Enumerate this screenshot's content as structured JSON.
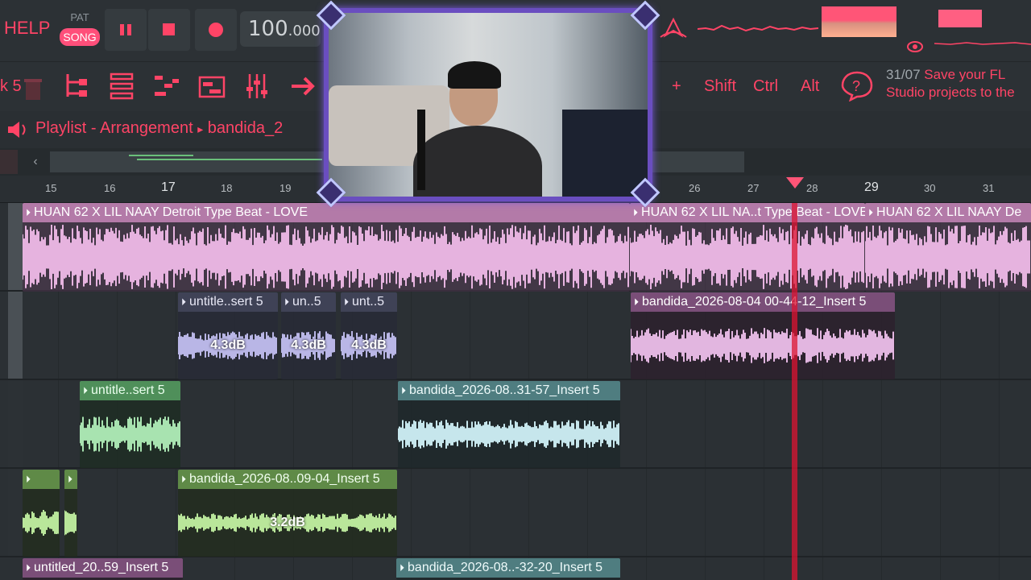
{
  "toolbar": {
    "help_label": "HELP",
    "pat_label": "PAT",
    "song_label": "SONG",
    "tempo_main": "100",
    "tempo_fraction": ".000",
    "accent": "#ff4466",
    "icons": [
      "pause-icon",
      "stop-icon",
      "record-icon",
      "tool-icon",
      "tempo-tap-icon"
    ]
  },
  "toolbar2": {
    "left_label": "k 5",
    "plus_label": "+",
    "keys": [
      "Shift",
      "Ctrl",
      "Alt"
    ],
    "hint_date": "31/07",
    "hint_line1": "Save your FL",
    "hint_line2": "Studio projects to the"
  },
  "playlist": {
    "title": "Playlist - Arrangement",
    "separator": "▸",
    "project": "bandida_2"
  },
  "ruler": {
    "ticks": [
      "15",
      "16",
      "17",
      "18",
      "19",
      "26",
      "27",
      "28",
      "29",
      "30",
      "31"
    ]
  },
  "tracks": [
    {
      "clips": [
        {
          "label": "HUAN 62 X LIL NAAY Detroit Type Beat - LOVE"
        },
        {
          "label": "HUAN 62 X LIL NA..t Type Beat - LOVE"
        },
        {
          "label": "HUAN 62 X LIL NAAY De"
        }
      ]
    },
    {
      "clips": [
        {
          "label": "untitle..sert 5",
          "db": "4.3dB"
        },
        {
          "label": "un..5",
          "db": "4.3dB"
        },
        {
          "label": "unt..5",
          "db": "4.3dB"
        },
        {
          "label": "bandida_2026-08-04 00-44-12_Insert 5"
        }
      ]
    },
    {
      "clips": [
        {
          "label": "untitle..sert 5"
        },
        {
          "label": "bandida_2026-08..31-57_Insert 5"
        }
      ]
    },
    {
      "clips": [
        {
          "label": ""
        },
        {
          "label": ""
        },
        {
          "label": "bandida_2026-08..09-04_Insert 5",
          "db": "3.2dB"
        }
      ]
    },
    {
      "clips": [
        {
          "label": "untitled_20..59_Insert 5"
        },
        {
          "label": "bandida_2026-08..-32-20_Insert 5"
        }
      ]
    }
  ]
}
